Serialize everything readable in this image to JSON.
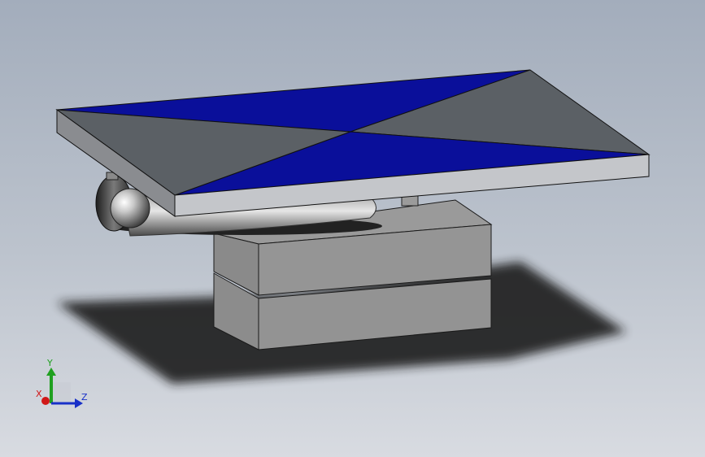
{
  "viewport": {
    "background_top": "#a3adbc",
    "background_bottom": "#d8dbe1"
  },
  "model": {
    "panel_blue": "#0a0f9a",
    "panel_gray": "#5b6065",
    "body_gray": "#8f8f8f",
    "edge_color": "#1a1a1a"
  },
  "triad": {
    "x_label": "X",
    "y_label": "Y",
    "z_label": "Z",
    "x_color": "#d01818",
    "y_color": "#20a020",
    "z_color": "#1830c8"
  }
}
